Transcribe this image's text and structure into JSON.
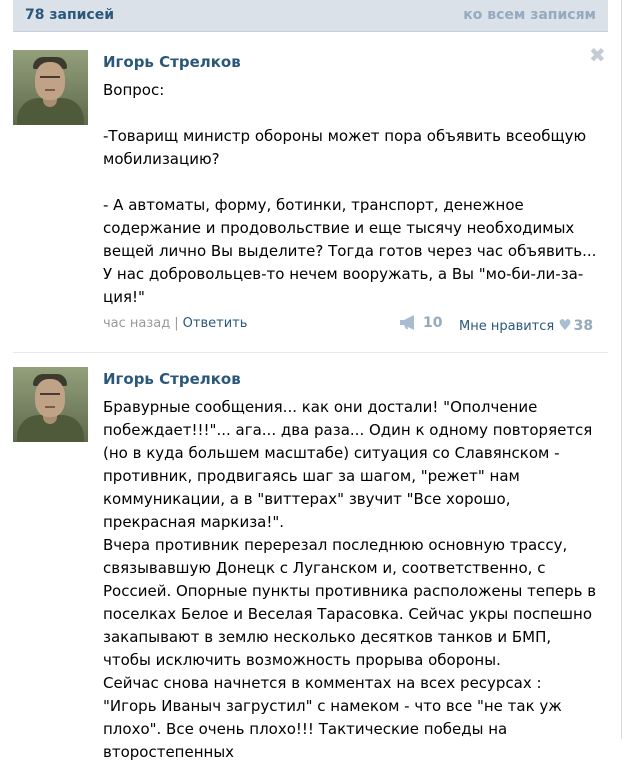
{
  "header": {
    "count_label": "78 записей",
    "all_link": "ко всем записям"
  },
  "posts": [
    {
      "author": "Игорь Стрелков",
      "text": "Вопрос:\n\n-Товарищ министр обороны может пора объявить всеобщую мобилизацию?\n\n- А автоматы, форму, ботинки, транспорт, денежное содержание и продовольствие и еще тысячу необходимых вещей лично Вы выделите? Тогда готов через час объявить... У нас добровольцев-то нечем вооружать, а Вы \"мо-би-ли-за-ция!\"",
      "time": "час назад",
      "separator": "|",
      "reply": "Ответить",
      "shares": "10",
      "like_label": "Мне нравится",
      "likes": "38"
    },
    {
      "author": "Игорь Стрелков",
      "text": "Бравурные сообщения... как они достали! \"Ополчение побеждает!!!\"... ага... два раза... Один к одному повторяется (но в куда большем масштабе) ситуация со Славянском - противник, продвигаясь шаг за шагом, \"режет\" нам коммуникации, а в \"виттерах\" звучит \"Все хорошо, прекрасная маркиза!\".\nВчера противник перерезал последнюю основную трассу, связывавшую Донецк с Луганском и, соответственно, с Россией. Опорные пункты противника расположены теперь в поселках Белое и Веселая Тарасовка. Сейчас укры поспешно закапывают в землю несколько десятков танков и БМП, чтобы исключить возможность прорыва обороны.\nСейчас снова начнется в комментах на всех ресурсах : \"Игорь Иваныч загрустил\" с намеком - что все \"не так уж плохо\". Все очень плохо!!! Тактические победы на второстепенных"
    }
  ],
  "icons": {
    "close": "close-icon",
    "share": "megaphone-icon",
    "like": "heart-icon"
  },
  "colors": {
    "link": "#2b587a",
    "header_bg": "#dae1e8",
    "muted": "#96aabe"
  }
}
